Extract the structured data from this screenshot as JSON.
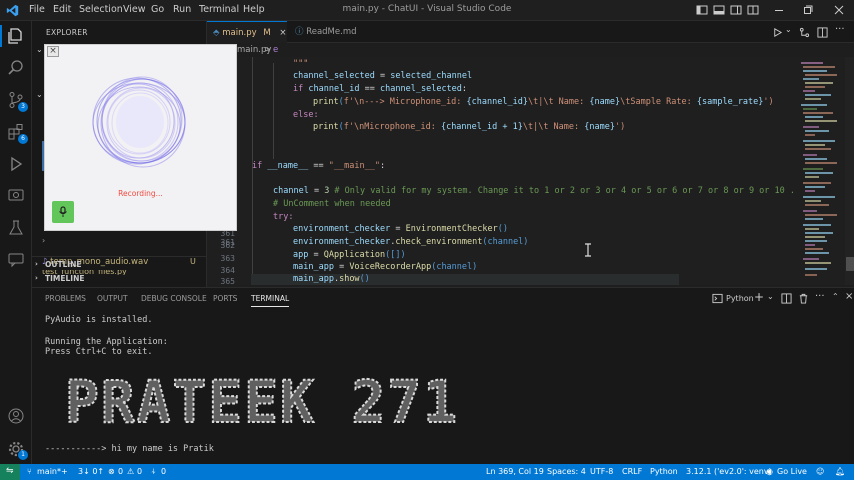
{
  "titlebar": {
    "menu": [
      "File",
      "Edit",
      "Selection",
      "View",
      "Go",
      "Run",
      "Terminal",
      "Help"
    ],
    "title": "main.py - ChatUI - Visual Studio Code"
  },
  "activity": {
    "source_control_badge": "3",
    "extensions_badge": "6",
    "accounts_badge": "1"
  },
  "sidebar": {
    "title": "EXPLORER",
    "file_name": "temp_mono_audio.wav",
    "file_status": "U",
    "cut_file": "test_function_files.py",
    "outline": "OUTLINE",
    "timeline": "TIMELINE"
  },
  "popup": {
    "close": "×",
    "status": "Recording..."
  },
  "tabs": [
    {
      "label": "main.py",
      "modifier": "M"
    },
    {
      "label": "ReadMe.md"
    }
  ],
  "breadcrumb": {
    "file": "main.py",
    "sep": ">",
    "symbol": "e"
  },
  "editor": {
    "line_numbers": [
      "361",
      "362",
      "363",
      "364",
      "365"
    ],
    "lines": {
      "docstring": "\"\"\"",
      "l1a": "channel_selected",
      "l1b": " = ",
      "l1c": "selected_channel",
      "l2a": "if ",
      "l2b": "channel_id",
      "l2c": " == ",
      "l2d": "channel_selected",
      "l2e": ":",
      "l3a": "print",
      "l3b": "(",
      "l3c": "f'\\n---> Microphone_id: ",
      "l3d": "{channel_id}",
      "l3e": "\\t|\\t Name: ",
      "l3f": "{name}",
      "l3g": "\\tSample Rate: ",
      "l3h": "{sample_rate}",
      "l3i": "')",
      "l4": "else:",
      "l5a": "print",
      "l5b": "(",
      "l5c": "f'\\nMicrophone_id: ",
      "l5d": "{channel_id + 1}",
      "l5e": "\\t|\\t Name: ",
      "l5f": "{name}",
      "l5g": "')",
      "l6a": "if ",
      "l6b": "__name__",
      "l6c": " == ",
      "l6d": "\"__main__\"",
      "l6e": ":",
      "l7a": "channel",
      "l7b": " = ",
      "l7c": "3",
      "l7d": " # Only valid for my system. Change it to 1 or 2 or 3 or 4 or 5 or 6 or 7 or 8 or 9 or 10 .",
      "l8": "# UnComment when needed",
      "l9": "try:",
      "l10a": "environment_checker",
      "l10b": " = ",
      "l10c": "EnvironmentChecker",
      "l10d": "()",
      "l11a": "environment_checker",
      "l11b": ".",
      "l11c": "check_environment",
      "l11d": "(channel)",
      "l12a": "app",
      "l12b": " = ",
      "l12c": "QApplication",
      "l12d": "([])",
      "l13a": "main_app",
      "l13b": " = ",
      "l13c": "VoiceRecorderApp",
      "l13d": "(channel)",
      "l14a": "main_app",
      "l14b": ".",
      "l14c": "show",
      "l14d": "()"
    }
  },
  "panel": {
    "tabs": [
      "PROBLEMS",
      "OUTPUT",
      "DEBUG CONSOLE",
      "PORTS",
      "TERMINAL"
    ],
    "shell": "Python",
    "terminal": {
      "l1": "PyAudio is installed.",
      "l2": "Running the Application:",
      "l3": "Press Ctrl+C to exit.",
      "banner": "PRATEEK 271",
      "l4": "-----------> hi my name is Pratik"
    }
  },
  "status": {
    "branch": "main*+",
    "sync": "3↓ 0↑",
    "errors": "0",
    "warnings": "0",
    "ports": "0",
    "position": "Ln 369, Col 19",
    "spaces": "Spaces: 4",
    "encoding": "UTF-8",
    "eol": "CRLF",
    "language": "Python",
    "interpreter": "3.12.1 ('ev2.0': venv)",
    "golive": "Go Live"
  }
}
